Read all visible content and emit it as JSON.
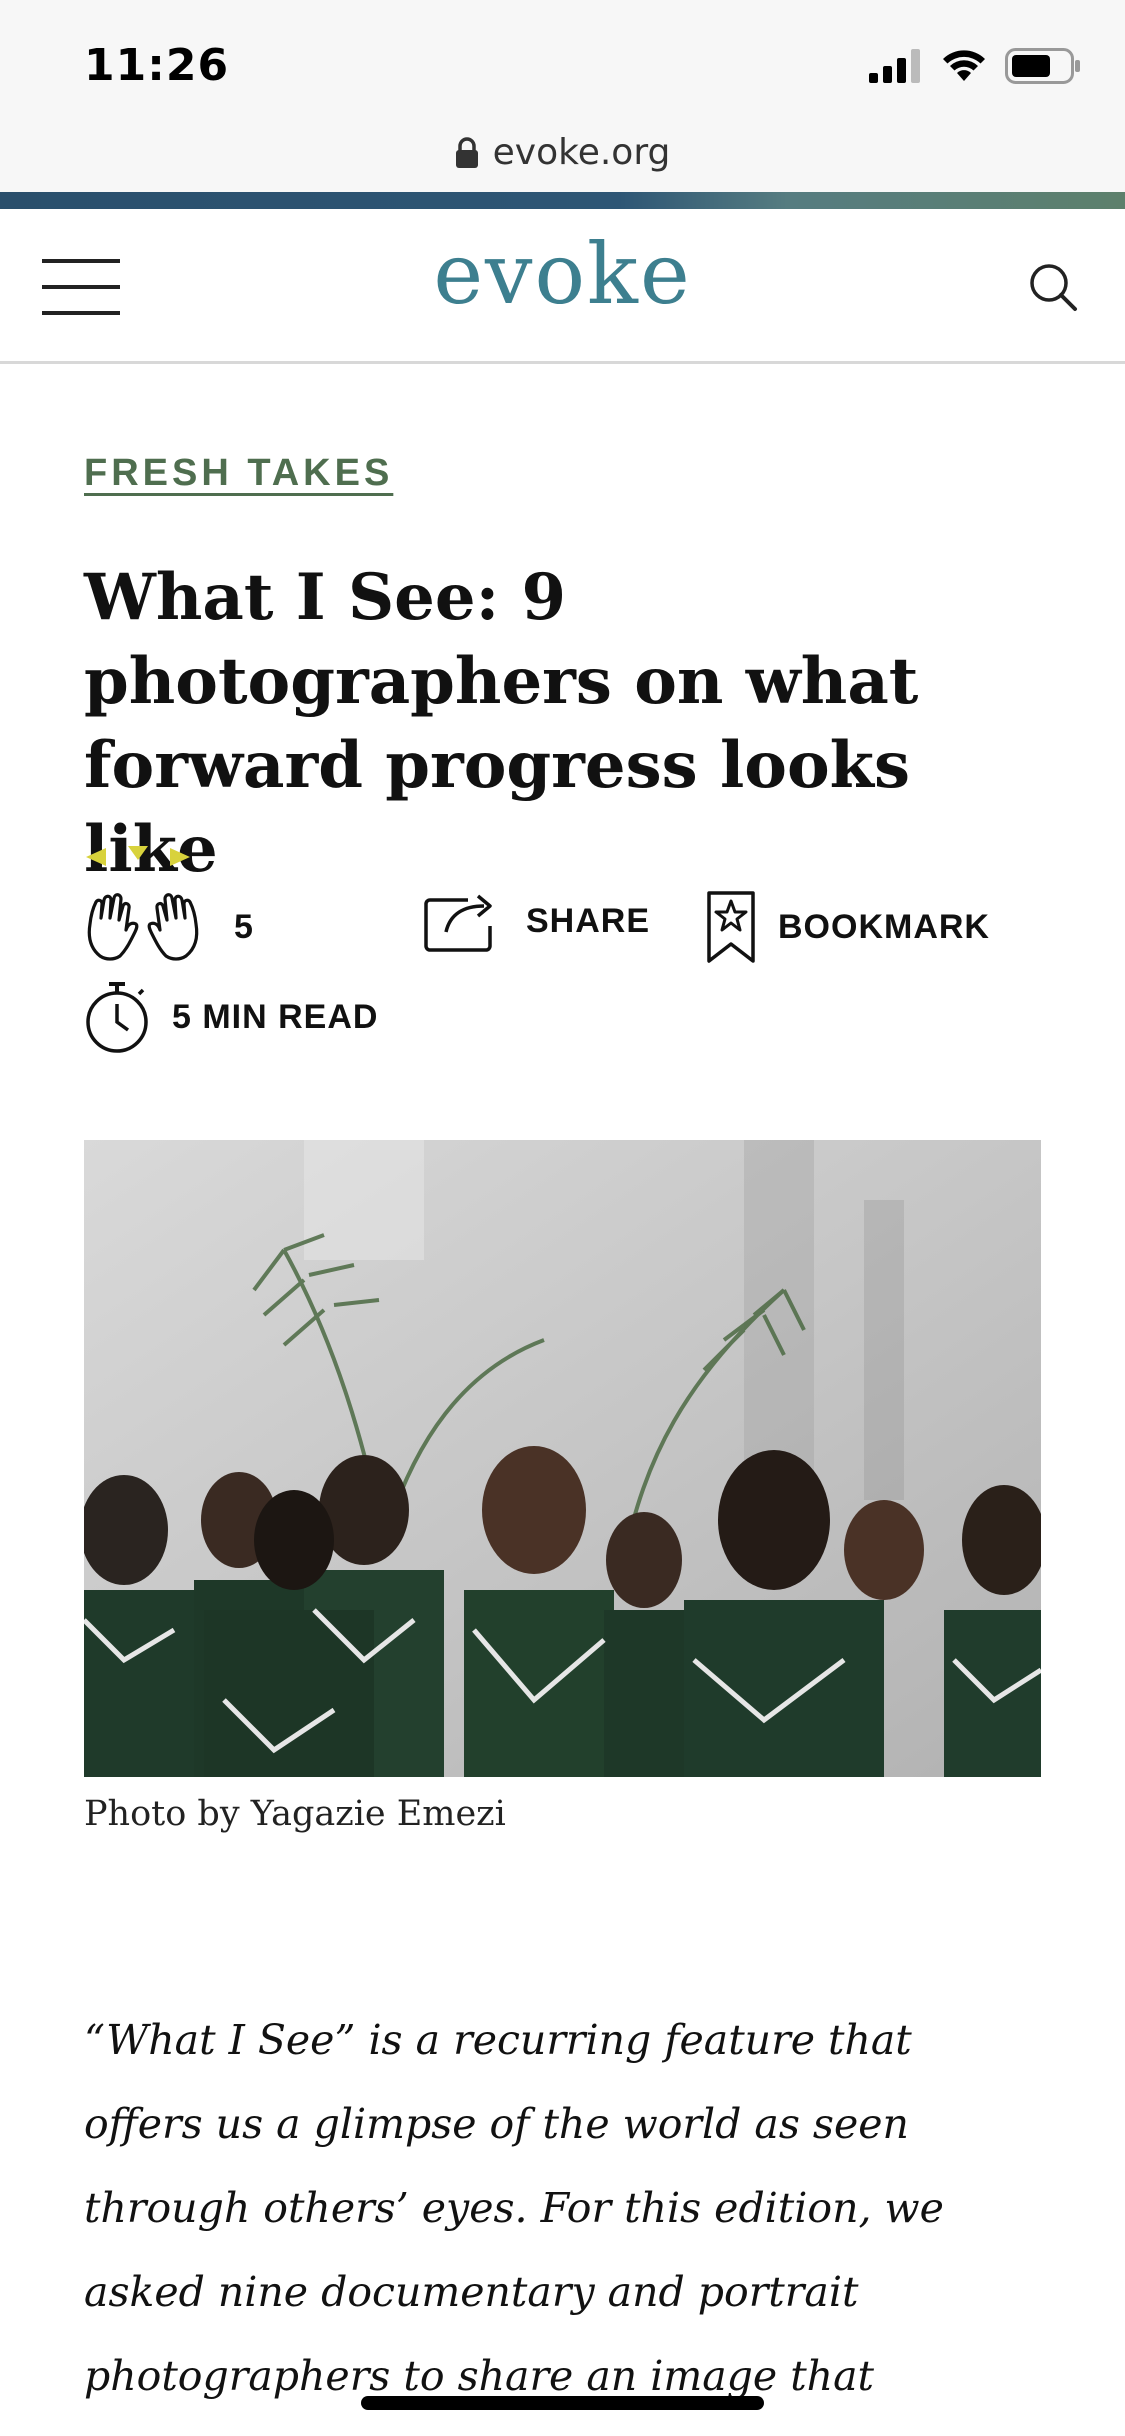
{
  "status_bar": {
    "time": "11:26",
    "icons": [
      "cellular-signal-icon",
      "wifi-icon",
      "battery-icon"
    ]
  },
  "browser": {
    "url": "evoke.org",
    "url_icon": "lock-icon"
  },
  "header": {
    "logo": "evoke",
    "menu_icon": "hamburger-menu-icon",
    "search_icon": "search-icon",
    "brand_color": "#3d7f8f",
    "band_colors": [
      "#2a4f6c",
      "#5d806c"
    ]
  },
  "article": {
    "category": "FRESH TAKES",
    "category_color": "#4f6e4f",
    "headline_lines": [
      "What I See: 9",
      "photographers on what",
      "forward progress looks like"
    ],
    "claps": {
      "count": "5",
      "icon": "clapping-hands-icon",
      "accent_color": "#d8d23c"
    },
    "share_label": "SHARE",
    "share_icon": "share-icon",
    "bookmark_label": "BOOKMARK",
    "bookmark_icon": "bookmark-star-icon",
    "read_time": "5 MIN READ",
    "read_time_icon": "stopwatch-icon",
    "photo_caption": "Photo by Yagazie Emezi",
    "lede_lines": [
      "“What I See” is a recurring feature that",
      "offers us a glimpse of the world as seen",
      "through others’ eyes. For this edition, we",
      "asked nine documentary and portrait",
      "photographers to share an image that"
    ]
  }
}
